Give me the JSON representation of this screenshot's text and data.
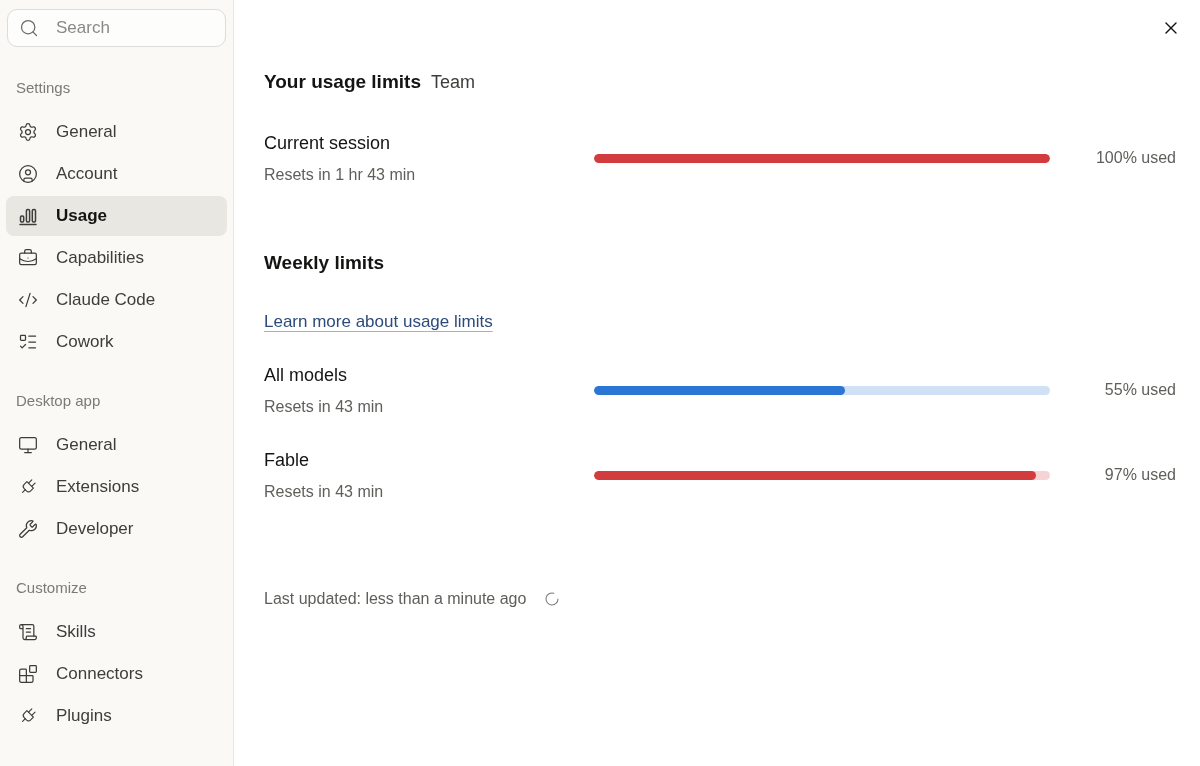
{
  "sidebar": {
    "search": {
      "placeholder": "Search"
    },
    "sections": [
      {
        "title": "Settings",
        "items": [
          {
            "label": "General",
            "selected": false
          },
          {
            "label": "Account",
            "selected": false
          },
          {
            "label": "Usage",
            "selected": true
          },
          {
            "label": "Capabilities",
            "selected": false
          },
          {
            "label": "Claude Code",
            "selected": false
          },
          {
            "label": "Cowork",
            "selected": false
          }
        ]
      },
      {
        "title": "Desktop app",
        "items": [
          {
            "label": "General",
            "selected": false
          },
          {
            "label": "Extensions",
            "selected": false
          },
          {
            "label": "Developer",
            "selected": false
          }
        ]
      },
      {
        "title": "Customize",
        "items": [
          {
            "label": "Skills",
            "selected": false
          },
          {
            "label": "Connectors",
            "selected": false
          },
          {
            "label": "Plugins",
            "selected": false
          }
        ]
      }
    ]
  },
  "usage": {
    "title": "Your usage limits",
    "plan": "Team",
    "session": {
      "name": "Current session",
      "resets": "Resets in 1 hr 43 min",
      "level": 1,
      "reading": "100% used",
      "color": "#d33c3e"
    },
    "weekly": {
      "title": "Weekly limits",
      "link": "Learn more about usage limits",
      "limits": [
        {
          "name": "All models",
          "resets": "Resets in 43 min",
          "level": 0.55,
          "reading": "55% used",
          "color": "#2b75d4"
        },
        {
          "name": "Fable",
          "resets": "Resets in 43 min",
          "level": 0.97,
          "reading": "97% used",
          "color": "#d33c3e"
        }
      ]
    },
    "last_updated": "Last updated: less than a minute ago"
  }
}
